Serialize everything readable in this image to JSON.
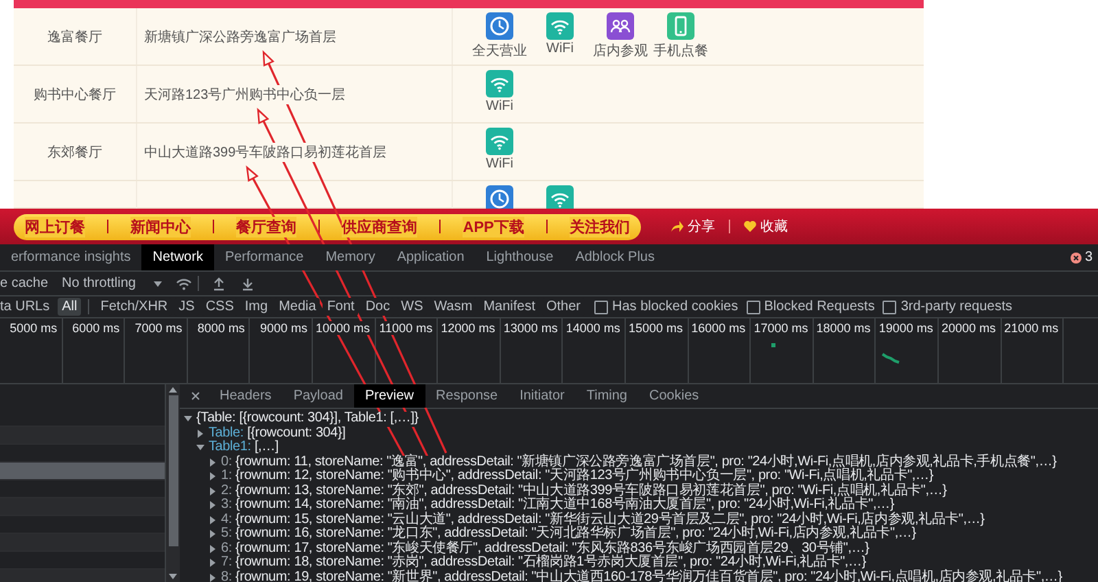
{
  "store_table": {
    "rows": [
      {
        "name": "逸富餐厅",
        "address": "新塘镇广深公路旁逸富广场首层",
        "features": [
          {
            "kind": "allday",
            "label": "全天营业"
          },
          {
            "kind": "wifi",
            "label": "WiFi"
          },
          {
            "kind": "tour",
            "label": "店内参观"
          },
          {
            "kind": "mobile",
            "label": "手机点餐"
          }
        ]
      },
      {
        "name": "购书中心餐厅",
        "address": "天河路123号广州购书中心负一层",
        "features": [
          {
            "kind": "wifi",
            "label": "WiFi"
          }
        ]
      },
      {
        "name": "东郊餐厅",
        "address": "中山大道路399号车陂路口易初莲花首层",
        "features": [
          {
            "kind": "wifi",
            "label": "WiFi"
          }
        ]
      },
      {
        "features": [
          {
            "kind": "allday"
          },
          {
            "kind": "wifi"
          }
        ]
      }
    ]
  },
  "nav": {
    "items": [
      "网上订餐",
      "新闻中心",
      "餐厅查询",
      "供应商查询",
      "APP下载",
      "关注我们"
    ],
    "actions": [
      {
        "kind": "share",
        "label": "分享"
      },
      {
        "kind": "favorite",
        "label": "收藏"
      }
    ]
  },
  "devtools": {
    "tabs": [
      {
        "label": "erformance insights",
        "selected": false
      },
      {
        "label": "Network",
        "selected": true
      },
      {
        "label": "Performance",
        "selected": false
      },
      {
        "label": "Memory",
        "selected": false
      },
      {
        "label": "Application",
        "selected": false
      },
      {
        "label": "Lighthouse",
        "selected": false
      },
      {
        "label": "Adblock Plus",
        "selected": false
      }
    ],
    "error_count": "3",
    "toolbar": {
      "cache_label": "e cache",
      "throttling": "No throttling"
    },
    "filters": {
      "invert_label": "ta URLs",
      "types": [
        {
          "label": "All",
          "selected": true
        },
        {
          "label": "Fetch/XHR",
          "selected": false
        },
        {
          "label": "JS",
          "selected": false
        },
        {
          "label": "CSS",
          "selected": false
        },
        {
          "label": "Img",
          "selected": false
        },
        {
          "label": "Media",
          "selected": false
        },
        {
          "label": "Font",
          "selected": false
        },
        {
          "label": "Doc",
          "selected": false
        },
        {
          "label": "WS",
          "selected": false
        },
        {
          "label": "Wasm",
          "selected": false
        },
        {
          "label": "Manifest",
          "selected": false
        },
        {
          "label": "Other",
          "selected": false
        }
      ],
      "checkboxes": [
        {
          "label": "Has blocked cookies",
          "checked": false
        },
        {
          "label": "Blocked Requests",
          "checked": false
        },
        {
          "label": "3rd-party requests",
          "checked": false
        }
      ]
    },
    "timeline": {
      "ticks": [
        "5000 ms",
        "6000 ms",
        "7000 ms",
        "8000 ms",
        "9000 ms",
        "10000 ms",
        "11000 ms",
        "12000 ms",
        "13000 ms",
        "14000 ms",
        "15000 ms",
        "16000 ms",
        "17000 ms",
        "18000 ms",
        "19000 ms",
        "20000 ms",
        "21000 ms"
      ]
    },
    "requests": [
      {
        "selected": false
      },
      {
        "selected": false
      },
      {
        "selected": false
      },
      {
        "selected": true
      },
      {
        "selected": false
      },
      {
        "selected": false
      },
      {
        "selected": false
      },
      {
        "selected": false
      },
      {
        "selected": false
      },
      {
        "selected": false
      }
    ],
    "detail_tabs": [
      {
        "label": "Headers",
        "selected": false
      },
      {
        "label": "Payload",
        "selected": false
      },
      {
        "label": "Preview",
        "selected": true
      },
      {
        "label": "Response",
        "selected": false
      },
      {
        "label": "Initiator",
        "selected": false
      },
      {
        "label": "Timing",
        "selected": false
      },
      {
        "label": "Cookies",
        "selected": false
      }
    ],
    "preview": {
      "tree": [
        {
          "value": "{Table: [{rowcount: 304}], Table1: [,…]}",
          "expanded": true,
          "children": [
            {
              "key": "Table:",
              "value": "[{rowcount: 304}]",
              "expanded": false
            },
            {
              "key": "Table1:",
              "value": "[,…]",
              "expanded": true,
              "children": [
                {
                  "key": "0:",
                  "value": "{rownum: 11, storeName: \"逸富\", addressDetail: \"新塘镇广深公路旁逸富广场首层\", pro: \"24小时,Wi-Fi,点唱机,店内参观,礼品卡,手机点餐\",…}",
                  "expanded": false
                },
                {
                  "key": "1:",
                  "value": "{rownum: 12, storeName: \"购书中心\", addressDetail: \"天河路123号广州购书中心负一层\", pro: \"Wi-Fi,点唱机,礼品卡\",…}",
                  "expanded": false
                },
                {
                  "key": "2:",
                  "value": "{rownum: 13, storeName: \"东郊\", addressDetail: \"中山大道路399号车陂路口易初莲花首层\", pro: \"Wi-Fi,点唱机,礼品卡\",…}",
                  "expanded": false
                },
                {
                  "key": "3:",
                  "value": "{rownum: 14, storeName: \"南油\", addressDetail: \"江南大道中168号南油大厦首层\", pro: \"24小时,Wi-Fi,礼品卡\",…}",
                  "expanded": false
                },
                {
                  "key": "4:",
                  "value": "{rownum: 15, storeName: \"云山大道\", addressDetail: \"新华街云山大道29号首层及二层\", pro: \"24小时,Wi-Fi,店内参观,礼品卡\",…}",
                  "expanded": false
                },
                {
                  "key": "5:",
                  "value": "{rownum: 16, storeName: \"龙口东\", addressDetail: \"天河北路华标广场首层\", pro: \"24小时,Wi-Fi,店内参观,礼品卡\",…}",
                  "expanded": false
                },
                {
                  "key": "6:",
                  "value": "{rownum: 17, storeName: \"东峻天使餐厅\", addressDetail: \"东风东路836号东峻广场西园首层29、30号铺\",…}",
                  "expanded": false
                },
                {
                  "key": "7:",
                  "value": "{rownum: 18, storeName: \"赤岗\", addressDetail: \"石榴岗路1号赤岗大厦首层\", pro: \"24小时,Wi-Fi,礼品卡\",…}",
                  "expanded": false
                },
                {
                  "key": "8:",
                  "value": "{rownum: 19, storeName: \"新世界\", addressDetail: \"中山大道西160-178号华润万佳百货首层\", pro: \"24小时,Wi-Fi,点唱机,店内参观,礼品卡\",…}",
                  "expanded": false
                }
              ]
            }
          ]
        }
      ]
    }
  }
}
